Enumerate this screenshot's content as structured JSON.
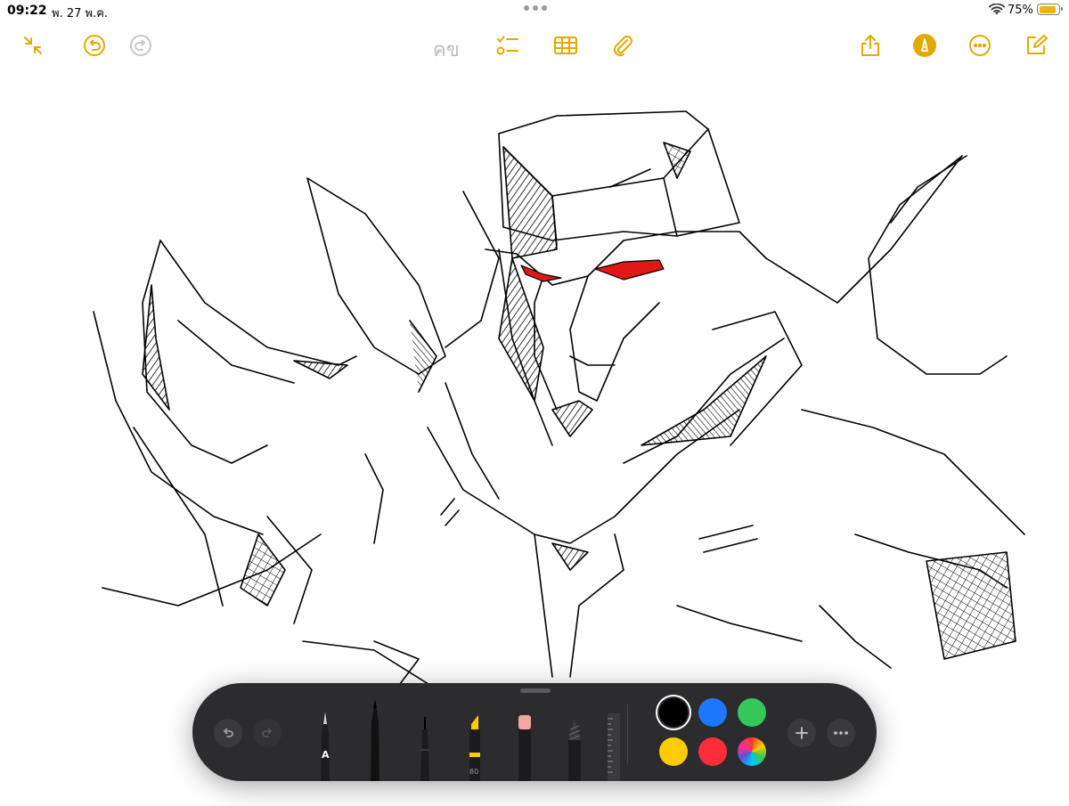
{
  "status_bar": {
    "time": "09:22",
    "date": "พ. 27 พ.ค.",
    "battery_percent": "75%",
    "battery_level": 0.75,
    "battery_color": "#f2b300"
  },
  "toolbar": {
    "accent_color": "#e3a900",
    "left": [
      {
        "name": "collapse-icon"
      },
      {
        "name": "undo-icon"
      },
      {
        "name": "redo-icon",
        "disabled": true
      }
    ],
    "center_text": "คข",
    "center": [
      {
        "name": "checklist-icon"
      },
      {
        "name": "table-icon"
      },
      {
        "name": "paperclip-icon"
      }
    ],
    "right": [
      {
        "name": "share-icon"
      },
      {
        "name": "markup-pen-icon",
        "active": true
      },
      {
        "name": "more-icon"
      },
      {
        "name": "compose-icon"
      }
    ]
  },
  "canvas": {
    "content": "hand-drawn sketch, black ink with red eyes",
    "eye_color": "#e01818"
  },
  "palette": {
    "background": "#2c2c2e",
    "tools": [
      "pen-monoline",
      "pen",
      "fineliner",
      "marker",
      "eraser",
      "pencil",
      "ruler"
    ],
    "pen_a_label": "A",
    "marker_opacity_label": "80",
    "colors": [
      {
        "name": "black",
        "hex": "#000000",
        "selected": true
      },
      {
        "name": "blue",
        "hex": "#1e78ff"
      },
      {
        "name": "green",
        "hex": "#34c759"
      },
      {
        "name": "yellow",
        "hex": "#ffcc00"
      },
      {
        "name": "red",
        "hex": "#ff2d3a"
      },
      {
        "name": "multicolor",
        "hex": "conic"
      }
    ]
  }
}
